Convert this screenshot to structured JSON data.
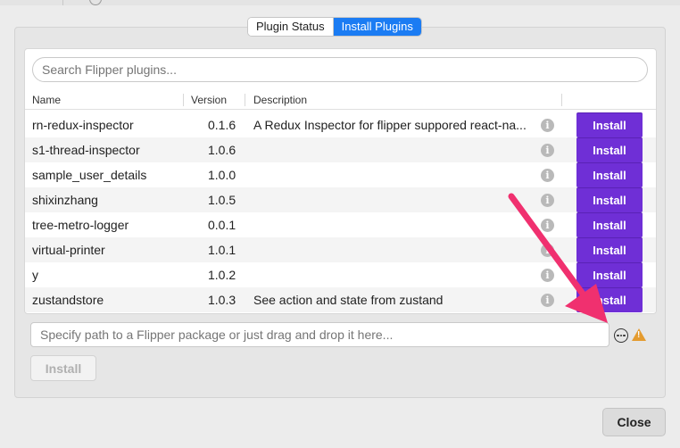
{
  "tabs": [
    {
      "label": "Plugin Status",
      "active": false
    },
    {
      "label": "Install Plugins",
      "active": true
    }
  ],
  "search": {
    "placeholder": "Search Flipper plugins..."
  },
  "table": {
    "columns": [
      "Name",
      "Version",
      "Description"
    ],
    "rows": [
      {
        "name": "rn-redux-inspector",
        "version": "0.1.6",
        "description": "A Redux Inspector for flipper suppored react-na...",
        "action": "Install"
      },
      {
        "name": "s1-thread-inspector",
        "version": "1.0.6",
        "description": "",
        "action": "Install"
      },
      {
        "name": "sample_user_details",
        "version": "1.0.0",
        "description": "",
        "action": "Install"
      },
      {
        "name": "shixinzhang",
        "version": "1.0.5",
        "description": "",
        "action": "Install"
      },
      {
        "name": "tree-metro-logger",
        "version": "0.0.1",
        "description": "",
        "action": "Install"
      },
      {
        "name": "virtual-printer",
        "version": "1.0.1",
        "description": "",
        "action": "Install"
      },
      {
        "name": "y",
        "version": "1.0.2",
        "description": "",
        "action": "Install"
      },
      {
        "name": "zustandstore",
        "version": "1.0.3",
        "description": "See action and state from zustand",
        "action": "Install"
      }
    ]
  },
  "package_path": {
    "placeholder": "Specify path to a Flipper package or just drag and drop it here..."
  },
  "install_button": "Install",
  "close_button": "Close",
  "icons": {
    "info": "info-icon",
    "more": "more-icon",
    "warning": "warning-icon"
  },
  "colors": {
    "accent": "#1b7cf3",
    "install": "#6f2fd6",
    "annotation_arrow": "#f0306f",
    "warning": "#e49b2f"
  }
}
